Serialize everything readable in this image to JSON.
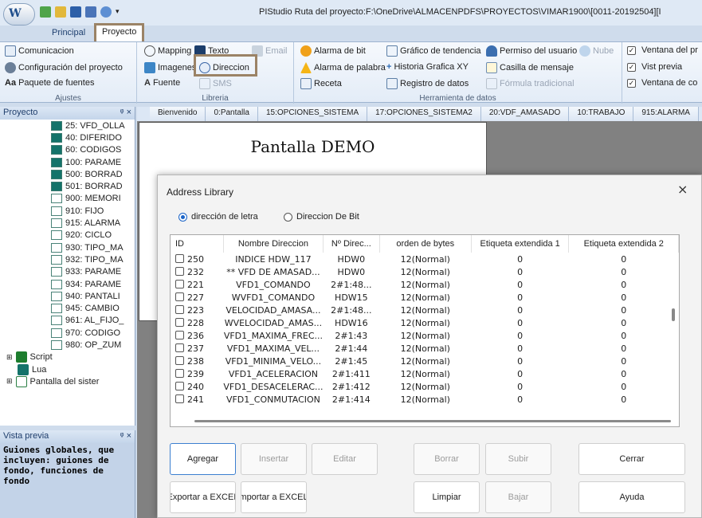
{
  "title_bar": {
    "text": "PIStudio  Ruta del proyecto:F:\\OneDrive\\ALMACENPDFS\\PROYECTOS\\VIMAR1900\\[0011-20192504][I"
  },
  "ribbon_tabs": {
    "principal": "Principal",
    "proyecto": "Proyecto"
  },
  "ribbon": {
    "ajustes": {
      "comunicacion": "Comunicacion",
      "configuracion": "Configuración del proyecto",
      "paquete": "Paquete de fuentes",
      "label": "Ajustes"
    },
    "libreria": {
      "mapping": "Mapping",
      "texto": "Texto",
      "email": "Email",
      "imagenes": "Imagenes",
      "direccion": "Direccion",
      "fuente": "Fuente",
      "sms": "SMS",
      "label": "Libreria"
    },
    "herramienta": {
      "alarma_bit": "Alarma de bit",
      "alarma_palabra": "Alarma de palabra",
      "receta": "Receta",
      "grafico_tendencia": "Gráfico de tendencia",
      "historia_grafica": "Historia Grafica XY",
      "registro": "Registro de datos",
      "permiso": "Permiso del usuario",
      "nube": "Nube",
      "casilla": "Casilla de mensaje",
      "formula": "Fórmula tradicional",
      "label": "Herramienta de datos"
    },
    "ventanas": {
      "ventana_del": "Ventana del pr",
      "vist_previa": "Vist previa",
      "ventana_de_co": "Ventana de co"
    }
  },
  "project_panel": {
    "title": "Proyecto",
    "pin": "ᵠ ×",
    "items": [
      {
        "label": "25: VFD_OLLA",
        "icon": "filled"
      },
      {
        "label": "40: DIFERIDO",
        "icon": "filled"
      },
      {
        "label": "60: CODIGOS",
        "icon": "filled"
      },
      {
        "label": "100: PARAME",
        "icon": "filled"
      },
      {
        "label": "500: BORRAD",
        "icon": "filled"
      },
      {
        "label": "501: BORRAD",
        "icon": "filled"
      },
      {
        "label": "900: MEMORI",
        "icon": "empty"
      },
      {
        "label": "910: FIJO",
        "icon": "empty"
      },
      {
        "label": "915: ALARMA",
        "icon": "empty"
      },
      {
        "label": "920: CICLO",
        "icon": "empty"
      },
      {
        "label": "930: TIPO_MA",
        "icon": "empty"
      },
      {
        "label": "932: TIPO_MA",
        "icon": "empty"
      },
      {
        "label": "933: PARAME",
        "icon": "empty"
      },
      {
        "label": "934: PARAME",
        "icon": "empty"
      },
      {
        "label": "940: PANTALI",
        "icon": "empty"
      },
      {
        "label": "945: CAMBIO",
        "icon": "empty"
      },
      {
        "label": "961: AL_FIJO_",
        "icon": "empty"
      },
      {
        "label": "970: CODIGO",
        "icon": "empty"
      },
      {
        "label": "980: OP_ZUM",
        "icon": "empty"
      }
    ],
    "bottom_items": [
      "Script",
      "Lua",
      "Pantalla del sister"
    ]
  },
  "preview_panel": {
    "title": "Vista previa",
    "pin": "ᵠ ×",
    "text": "Guiones globales, que incluyen: guiones de fondo, funciones de fondo"
  },
  "doc_tabs": [
    "Bienvenido",
    "0:Pantalla",
    "15:OPCIONES_SISTEMA",
    "17:OPCIONES_SISTEMA2",
    "20:VDF_AMASADO",
    "10:TRABAJO",
    "915:ALARMA"
  ],
  "canvas": {
    "demo_title": "Pantalla DEMO"
  },
  "dialog": {
    "title": "Address Library",
    "close": "×",
    "radio_word": "dirección de letra",
    "radio_bit": "Direccion De Bit",
    "columns": [
      "ID",
      "Nombre Direccion",
      "Nº Direc...",
      "orden de bytes",
      "Etiqueta extendida 1",
      "Etiqueta extendida 2"
    ],
    "rows": [
      [
        "250",
        "INDICE HDW_117",
        "HDW0",
        "12(Normal)",
        "0",
        "0"
      ],
      [
        "232",
        "** VFD DE AMASAD...",
        "HDW0",
        "12(Normal)",
        "0",
        "0"
      ],
      [
        "221",
        "VFD1_COMANDO",
        "2#1:48...",
        "12(Normal)",
        "0",
        "0"
      ],
      [
        "227",
        "WVFD1_COMANDO",
        "HDW15",
        "12(Normal)",
        "0",
        "0"
      ],
      [
        "223",
        "VELOCIDAD_AMASA...",
        "2#1:48...",
        "12(Normal)",
        "0",
        "0"
      ],
      [
        "228",
        "WVELOCIDAD_AMAS...",
        "HDW16",
        "12(Normal)",
        "0",
        "0"
      ],
      [
        "236",
        "VFD1_MAXIMA_FREC...",
        "2#1:43",
        "12(Normal)",
        "0",
        "0"
      ],
      [
        "237",
        "VFD1_MAXIMA_VEL...",
        "2#1:44",
        "12(Normal)",
        "0",
        "0"
      ],
      [
        "238",
        "VFD1_MINIMA_VELO...",
        "2#1:45",
        "12(Normal)",
        "0",
        "0"
      ],
      [
        "239",
        "VFD1_ACELERACION",
        "2#1:411",
        "12(Normal)",
        "0",
        "0"
      ],
      [
        "240",
        "VFD1_DESACELERAC...",
        "2#1:412",
        "12(Normal)",
        "0",
        "0"
      ],
      [
        "241",
        "VFD1_CONMUTACION",
        "2#1:414",
        "12(Normal)",
        "0",
        "0"
      ]
    ],
    "buttons": {
      "agregar": "Agregar",
      "insertar": "Insertar",
      "editar": "Editar",
      "borrar": "Borrar",
      "subir": "Subir",
      "cerrar": "Cerrar",
      "exportar": "Exportar a EXCEL",
      "importar": "mportar a EXCEL",
      "limpiar": "Limpiar",
      "bajar": "Bajar",
      "ayuda": "Ayuda"
    }
  }
}
